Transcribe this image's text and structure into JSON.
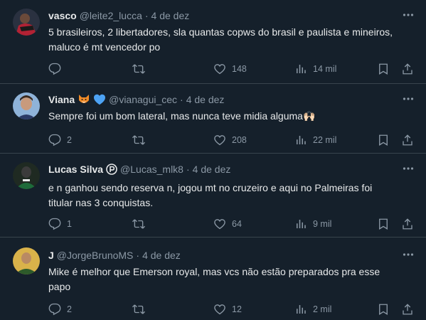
{
  "colors": {
    "background": "#15202b",
    "text_primary": "#e7e9ea",
    "text_secondary": "#8b98a5",
    "divider": "#38444d"
  },
  "tweets": [
    {
      "name": "vasco",
      "handle": "@leite2_lucca",
      "dot": "·",
      "date": "4 de dez",
      "badges": [],
      "lines": [
        "5 brasileiros, 2 libertadores, sla quantas copws do brasil e paulista e mineiros,",
        "maluco é mt vencedor po"
      ],
      "replies": "",
      "retweets": "",
      "likes": "148",
      "views": "14 mil"
    },
    {
      "name": "Viana",
      "handle": "@vianagui_cec",
      "dot": "·",
      "date": "4 de dez",
      "badges": [
        "fox-emoji",
        "blue-heart-emoji"
      ],
      "lines": [
        "Sempre foi um bom lateral, mas nunca teve midia alguma🙌🏻"
      ],
      "replies": "2",
      "retweets": "",
      "likes": "208",
      "views": "22 mil"
    },
    {
      "name": "Lucas Silva",
      "handle": "@Lucas_mlk8",
      "dot": "·",
      "date": "4 de dez",
      "badges": [
        "palmeiras-p-icon"
      ],
      "lines": [
        "e n ganhou sendo reserva n, jogou mt no cruzeiro e aqui no Palmeiras foi",
        "titular nas 3 conquistas."
      ],
      "replies": "1",
      "retweets": "",
      "likes": "64",
      "views": "9 mil"
    },
    {
      "name": "J",
      "handle": "@JorgeBrunoMS",
      "dot": "·",
      "date": "4 de dez",
      "badges": [],
      "lines": [
        "Mike é melhor que Emerson royal, mas vcs não estão preparados pra esse",
        "papo"
      ],
      "replies": "2",
      "retweets": "",
      "likes": "12",
      "views": "2 mil"
    }
  ]
}
